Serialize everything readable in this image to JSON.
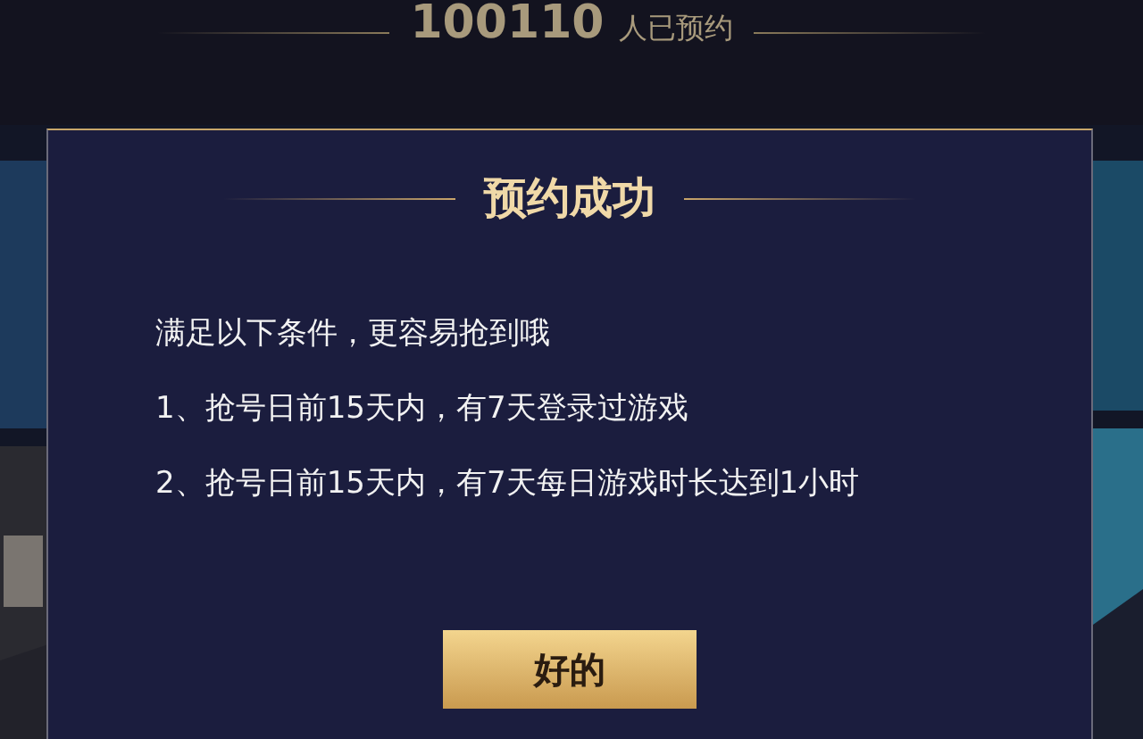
{
  "reservation_count": {
    "number": "100110",
    "label": "人已预约"
  },
  "dialog": {
    "title": "预约成功",
    "lines": [
      "满足以下条件，更容易抢到哦",
      "1、抢号日前15天内，有7天登录过游戏",
      "2、抢号日前15天内，有7天每日游戏时长达到1小时"
    ],
    "button": "好的"
  }
}
